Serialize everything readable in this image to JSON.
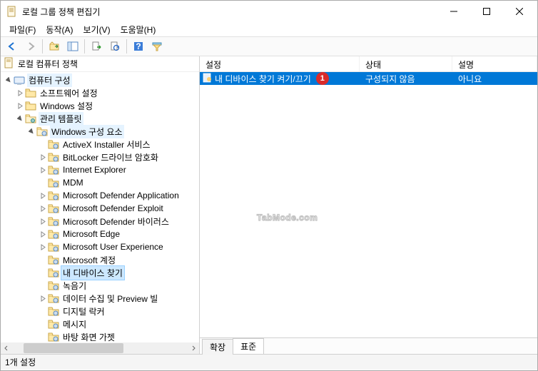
{
  "window": {
    "title": "로컬 그룹 정책 편집기"
  },
  "menu": {
    "file": "파일(F)",
    "action": "동작(A)",
    "view": "보기(V)",
    "help": "도움말(H)"
  },
  "tree": {
    "root": "로컬 컴퓨터 정책",
    "computer_config": "컴퓨터 구성",
    "software_settings": "소프트웨어 설정",
    "windows_settings": "Windows 설정",
    "admin_templates": "관리 템플릿",
    "windows_components": "Windows 구성 요소",
    "items": [
      "ActiveX Installer 서비스",
      "BitLocker 드라이브 암호화",
      "Internet Explorer",
      "MDM",
      "Microsoft Defender Application",
      "Microsoft Defender Exploit",
      "Microsoft Defender 바이러스",
      "Microsoft Edge",
      "Microsoft User Experience",
      "Microsoft 계정",
      "내 디바이스 찾기",
      "녹음기",
      "데이터 수집 및 Preview 빌",
      "디지털 락커",
      "메시지",
      "바탕 화면 가젯"
    ]
  },
  "columns": {
    "setting": "설정",
    "state": "상태",
    "description": "설명"
  },
  "list": {
    "row1": {
      "name": "내 디바이스 찾기 켜기/끄기",
      "state": "구성되지 않음",
      "desc": "아니요",
      "badge": "1"
    }
  },
  "tabs": {
    "extended": "확장",
    "standard": "표준"
  },
  "status": "1개 설정",
  "watermark": "TabMode.com"
}
